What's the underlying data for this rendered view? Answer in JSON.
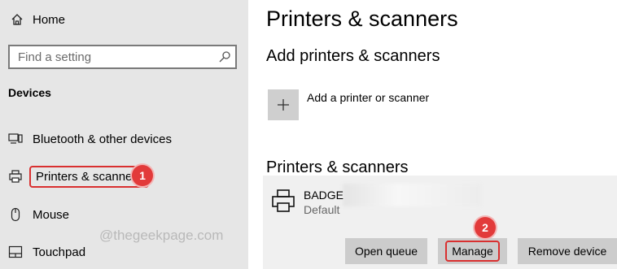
{
  "sidebar": {
    "home_label": "Home",
    "search_placeholder": "Find a setting",
    "section_title": "Devices",
    "items": [
      {
        "label": "Bluetooth & other devices",
        "icon": "bluetooth-devices-icon"
      },
      {
        "label": "Printers & scanners",
        "icon": "printer-icon",
        "selected": true
      },
      {
        "label": "Mouse",
        "icon": "mouse-icon"
      },
      {
        "label": "Touchpad",
        "icon": "touchpad-icon"
      }
    ]
  },
  "main": {
    "title": "Printers & scanners",
    "add_section_title": "Add printers & scanners",
    "add_label": "Add a printer or scanner",
    "list_section_title": "Printers & scanners",
    "printer": {
      "name": "BADGE",
      "status": "Default",
      "buttons": {
        "open_queue": "Open queue",
        "manage": "Manage",
        "remove": "Remove device"
      }
    }
  },
  "annotations": {
    "step1": "1",
    "step2": "2"
  },
  "watermark": "@thegeekpage.com",
  "colors": {
    "highlight": "#d93030",
    "badge": "#e23a3a",
    "sidebar_bg": "#e6e6e6",
    "button_bg": "#cccccc"
  }
}
